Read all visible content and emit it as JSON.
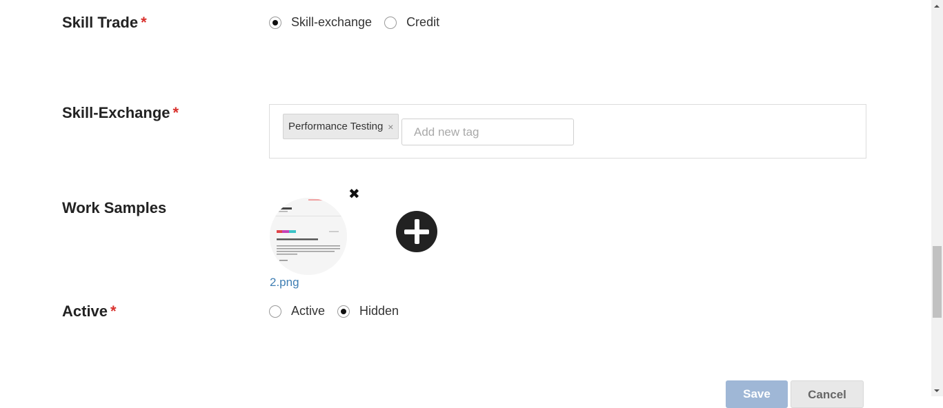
{
  "skill_trade": {
    "label": "Skill Trade",
    "required_mark": "*",
    "options": [
      {
        "label": "Skill-exchange",
        "selected": true
      },
      {
        "label": "Credit",
        "selected": false
      }
    ]
  },
  "skill_exchange": {
    "label": "Skill-Exchange",
    "required_mark": "*",
    "tags": [
      {
        "label": "Performance Testing",
        "remove": "×"
      }
    ],
    "input_placeholder": "Add new tag"
  },
  "work_samples": {
    "label": "Work Samples",
    "remove_icon": "close-icon",
    "add_icon": "plus-circle-icon",
    "files": [
      {
        "name": "2.png"
      }
    ]
  },
  "active": {
    "label": "Active",
    "required_mark": "*",
    "options": [
      {
        "label": "Active",
        "selected": false
      },
      {
        "label": "Hidden",
        "selected": true
      }
    ]
  },
  "actions": {
    "save_label": "Save",
    "cancel_label": "Cancel"
  },
  "colors": {
    "required": "#d9302c",
    "link": "#3f7eb3",
    "save_button": "#9fb7d6"
  }
}
